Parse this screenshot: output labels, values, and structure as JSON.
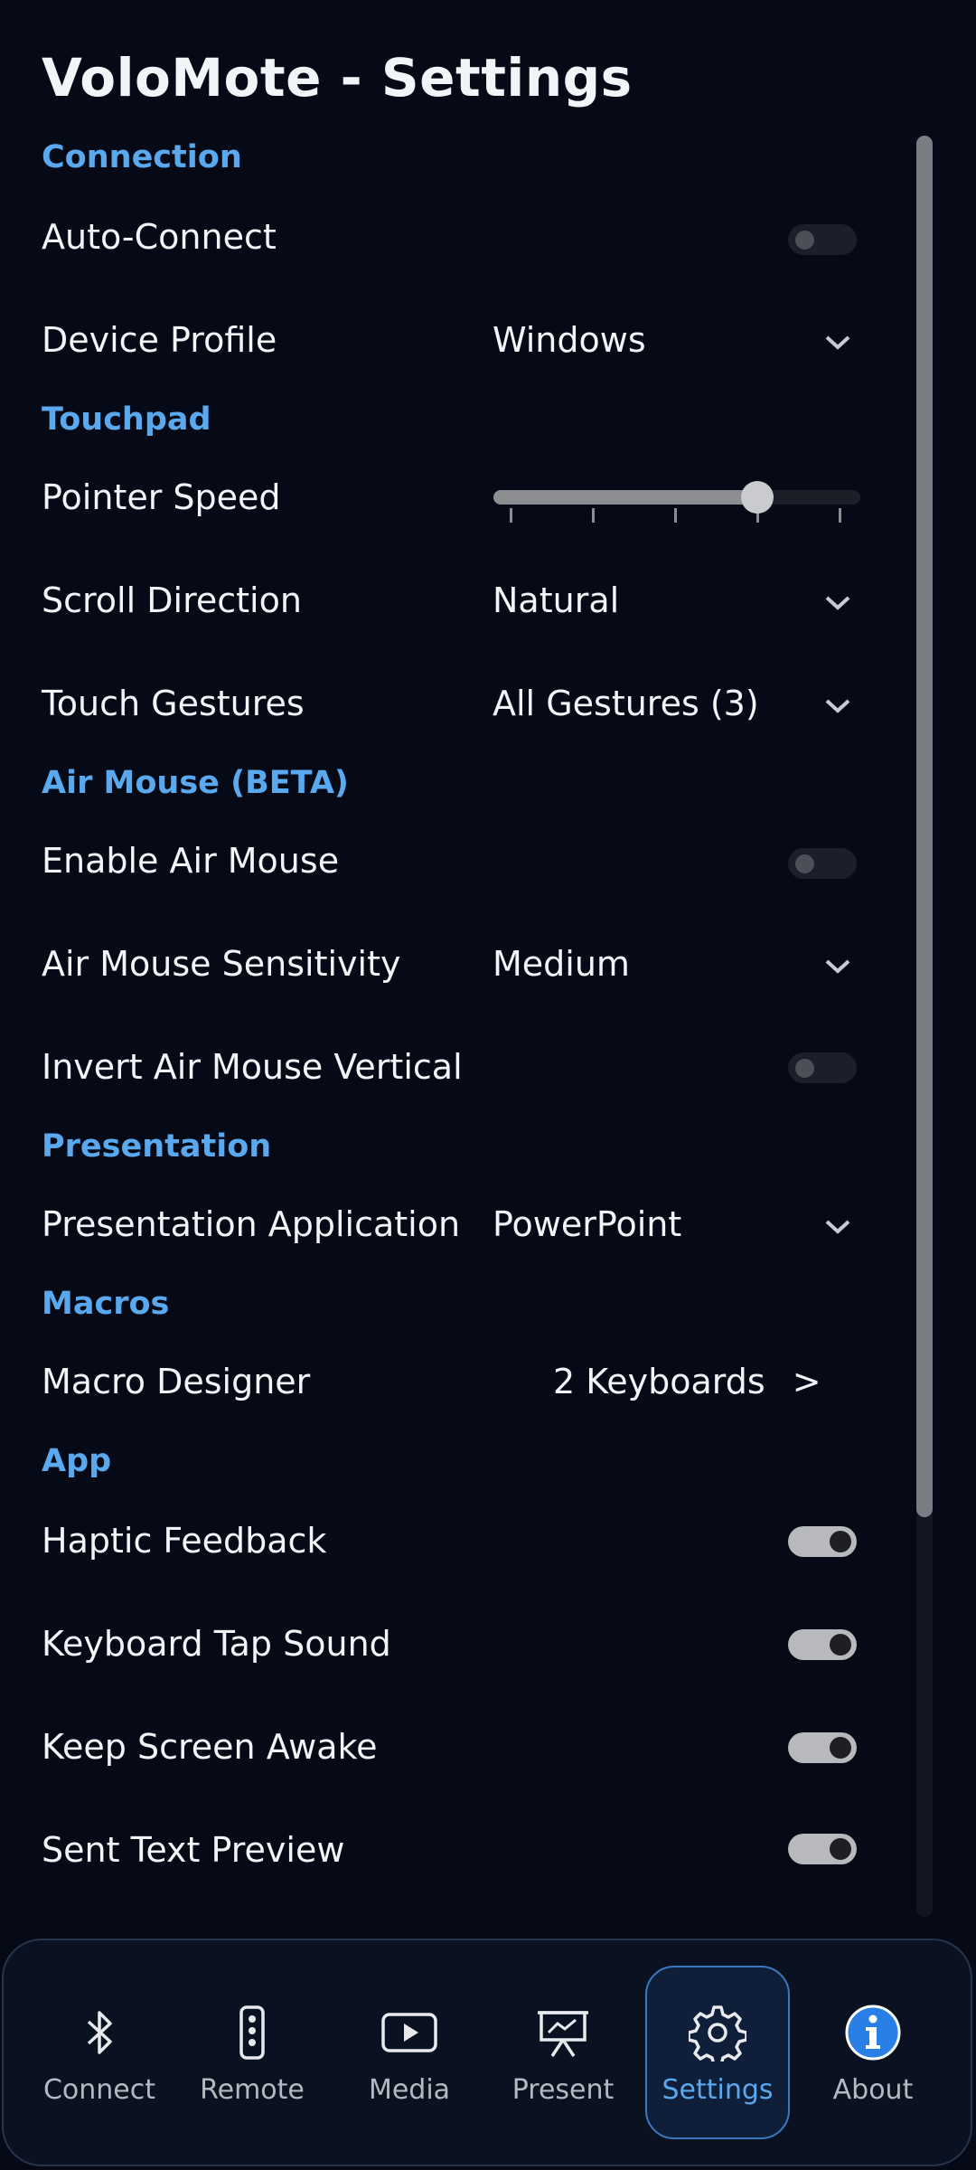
{
  "header": {
    "title": "VoloMote - Settings"
  },
  "sections": {
    "connection": "Connection",
    "touchpad": "Touchpad",
    "air_mouse": "Air Mouse (BETA)",
    "presentation": "Presentation",
    "macros": "Macros",
    "app": "App"
  },
  "settings": {
    "auto_connect": {
      "label": "Auto-Connect",
      "enabled": false
    },
    "device_profile": {
      "label": "Device Profile",
      "value": "Windows"
    },
    "pointer_speed": {
      "label": "Pointer Speed",
      "level_fraction": 0.72,
      "tick_count": 5
    },
    "scroll_direction": {
      "label": "Scroll Direction",
      "value": "Natural"
    },
    "touch_gestures": {
      "label": "Touch Gestures",
      "value": "All Gestures (3)"
    },
    "enable_air_mouse": {
      "label": "Enable Air Mouse",
      "enabled": false
    },
    "air_mouse_sensitivity": {
      "label": "Air Mouse Sensitivity",
      "value": "Medium"
    },
    "invert_air_mouse": {
      "label": "Invert Air Mouse Vertical",
      "enabled": false
    },
    "presentation_app": {
      "label": "Presentation Application",
      "value": "PowerPoint"
    },
    "macro_designer": {
      "label": "Macro Designer",
      "value": "2 Keyboards",
      "arrow": ">"
    },
    "haptic_feedback": {
      "label": "Haptic Feedback",
      "enabled": true
    },
    "keyboard_tap_sound": {
      "label": "Keyboard Tap Sound",
      "enabled": true
    },
    "keep_screen_awake": {
      "label": "Keep Screen Awake",
      "enabled": true
    },
    "sent_text_preview": {
      "label": "Sent Text Preview",
      "enabled": true
    }
  },
  "nav": {
    "active": "settings",
    "items": [
      {
        "id": "connect",
        "label": "Connect",
        "icon": "bluetooth-icon"
      },
      {
        "id": "remote",
        "label": "Remote",
        "icon": "remote-icon"
      },
      {
        "id": "media",
        "label": "Media",
        "icon": "play-icon"
      },
      {
        "id": "present",
        "label": "Present",
        "icon": "presentation-icon"
      },
      {
        "id": "settings",
        "label": "Settings",
        "icon": "gear-icon"
      },
      {
        "id": "about",
        "label": "About",
        "icon": "info-icon"
      }
    ]
  },
  "colors": {
    "accent": "#5aa8ee",
    "background": "#050a16",
    "info_blue": "#2a7fe6"
  }
}
